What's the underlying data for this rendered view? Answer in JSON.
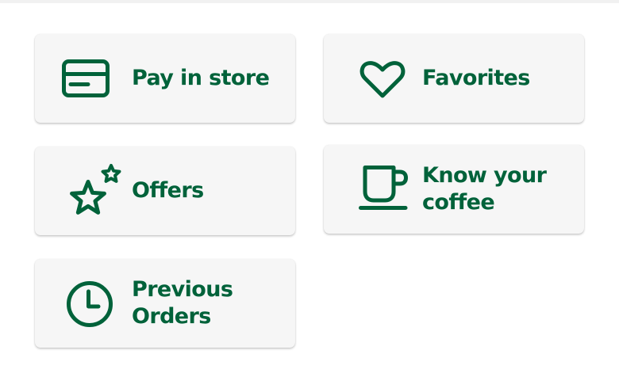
{
  "colors": {
    "brand_green": "#00623a",
    "tile_background": "#f6f6f6"
  },
  "tiles": [
    {
      "id": "pay-in-store",
      "icon": "credit-card-icon",
      "label": "Pay in store"
    },
    {
      "id": "favorites",
      "icon": "heart-icon",
      "label": "Favorites"
    },
    {
      "id": "offers",
      "icon": "stars-icon",
      "label": "Offers"
    },
    {
      "id": "know-your-coffee",
      "icon": "coffee-cup-icon",
      "label_lines": [
        "Know your",
        "coffee"
      ]
    },
    {
      "id": "previous-orders",
      "icon": "clock-icon",
      "label_lines": [
        "Previous",
        "Orders"
      ]
    }
  ]
}
